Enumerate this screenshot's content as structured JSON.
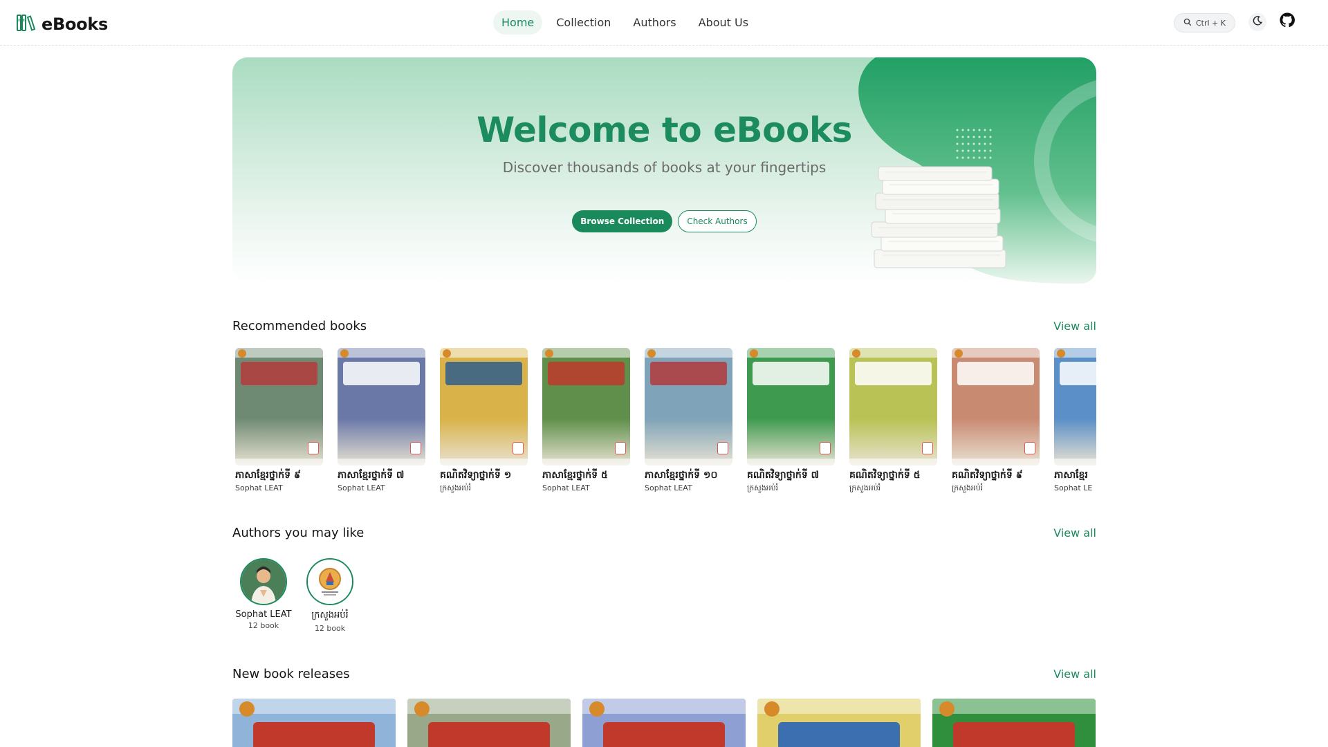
{
  "header": {
    "brand": "eBooks",
    "nav": [
      "Home",
      "Collection",
      "Authors",
      "About Us"
    ],
    "active_nav": "Home",
    "search_shortcut": "Ctrl + K",
    "icons": [
      "books-logo-icon",
      "search-icon",
      "moon-icon",
      "github-icon"
    ]
  },
  "hero": {
    "title": "Welcome to eBooks",
    "subtitle": "Discover thousands of books at your fingertips",
    "primary_button": "Browse Collection",
    "secondary_button": "Check Authors"
  },
  "recommended": {
    "title": "Recommended books",
    "view_all": "View all",
    "books": [
      {
        "title": "ភាសាខ្មែរថ្នាក់ទី ៩",
        "author": "Sophat LEAT",
        "cover": "#6f8a73",
        "accent": "#b33b3b"
      },
      {
        "title": "ភាសាខ្មែរថ្នាក់ទី ៧",
        "author": "Sophat LEAT",
        "cover": "#6a78a8",
        "accent": "#ffffff"
      },
      {
        "title": "គណិតវិទ្យាថ្នាក់ទី ១",
        "author": "ក្រសួងអប់រំ",
        "cover": "#d9b34a",
        "accent": "#2f5e8c"
      },
      {
        "title": "ភាសាខ្មែរថ្នាក់ទី ៥",
        "author": "Sophat LEAT",
        "cover": "#5f8f4a",
        "accent": "#c0392b"
      },
      {
        "title": "ភាសាខ្មែរថ្នាក់ទី ១០",
        "author": "Sophat LEAT",
        "cover": "#7fa3b8",
        "accent": "#b33b3b"
      },
      {
        "title": "គណិតវិទ្យាថ្នាក់ទី ៧",
        "author": "ក្រសួងអប់រំ",
        "cover": "#3e9a4e",
        "accent": "#ffffff"
      },
      {
        "title": "គណិតវិទ្យាថ្នាក់ទី ៥",
        "author": "ក្រសួងអប់រំ",
        "cover": "#b9c254",
        "accent": "#ffffff"
      },
      {
        "title": "គណិតវិទ្យាថ្នាក់ទី ៩",
        "author": "ក្រសួងអប់រំ",
        "cover": "#c98a72",
        "accent": "#ffffff"
      },
      {
        "title": "ភាសាខ្មែរ",
        "author": "Sophat LE",
        "cover": "#5b8fc7",
        "accent": "#ffffff"
      }
    ]
  },
  "authors": {
    "title": "Authors you may like",
    "view_all": "View all",
    "list": [
      {
        "name": "Sophat LEAT",
        "count": "12 book",
        "avatar": "#3f7a4c"
      },
      {
        "name": "ក្រសួងអប់រំ",
        "count": "12 book",
        "avatar": "#e9f2ee"
      }
    ]
  },
  "new_releases": {
    "title": "New book releases",
    "view_all": "View all",
    "covers": [
      {
        "color": "#8fb3d9",
        "accent": "#c0392b"
      },
      {
        "color": "#9aa88a",
        "accent": "#c0392b"
      },
      {
        "color": "#8e9fd4",
        "accent": "#c0392b"
      },
      {
        "color": "#e0cf6a",
        "accent": "#3c6fb0"
      },
      {
        "color": "#2f8f3d",
        "accent": "#c0392b"
      }
    ]
  },
  "colors": {
    "accent": "#1a8a5c",
    "hero_title": "#1c8c5e",
    "hero_blob": "#2aa46a"
  }
}
